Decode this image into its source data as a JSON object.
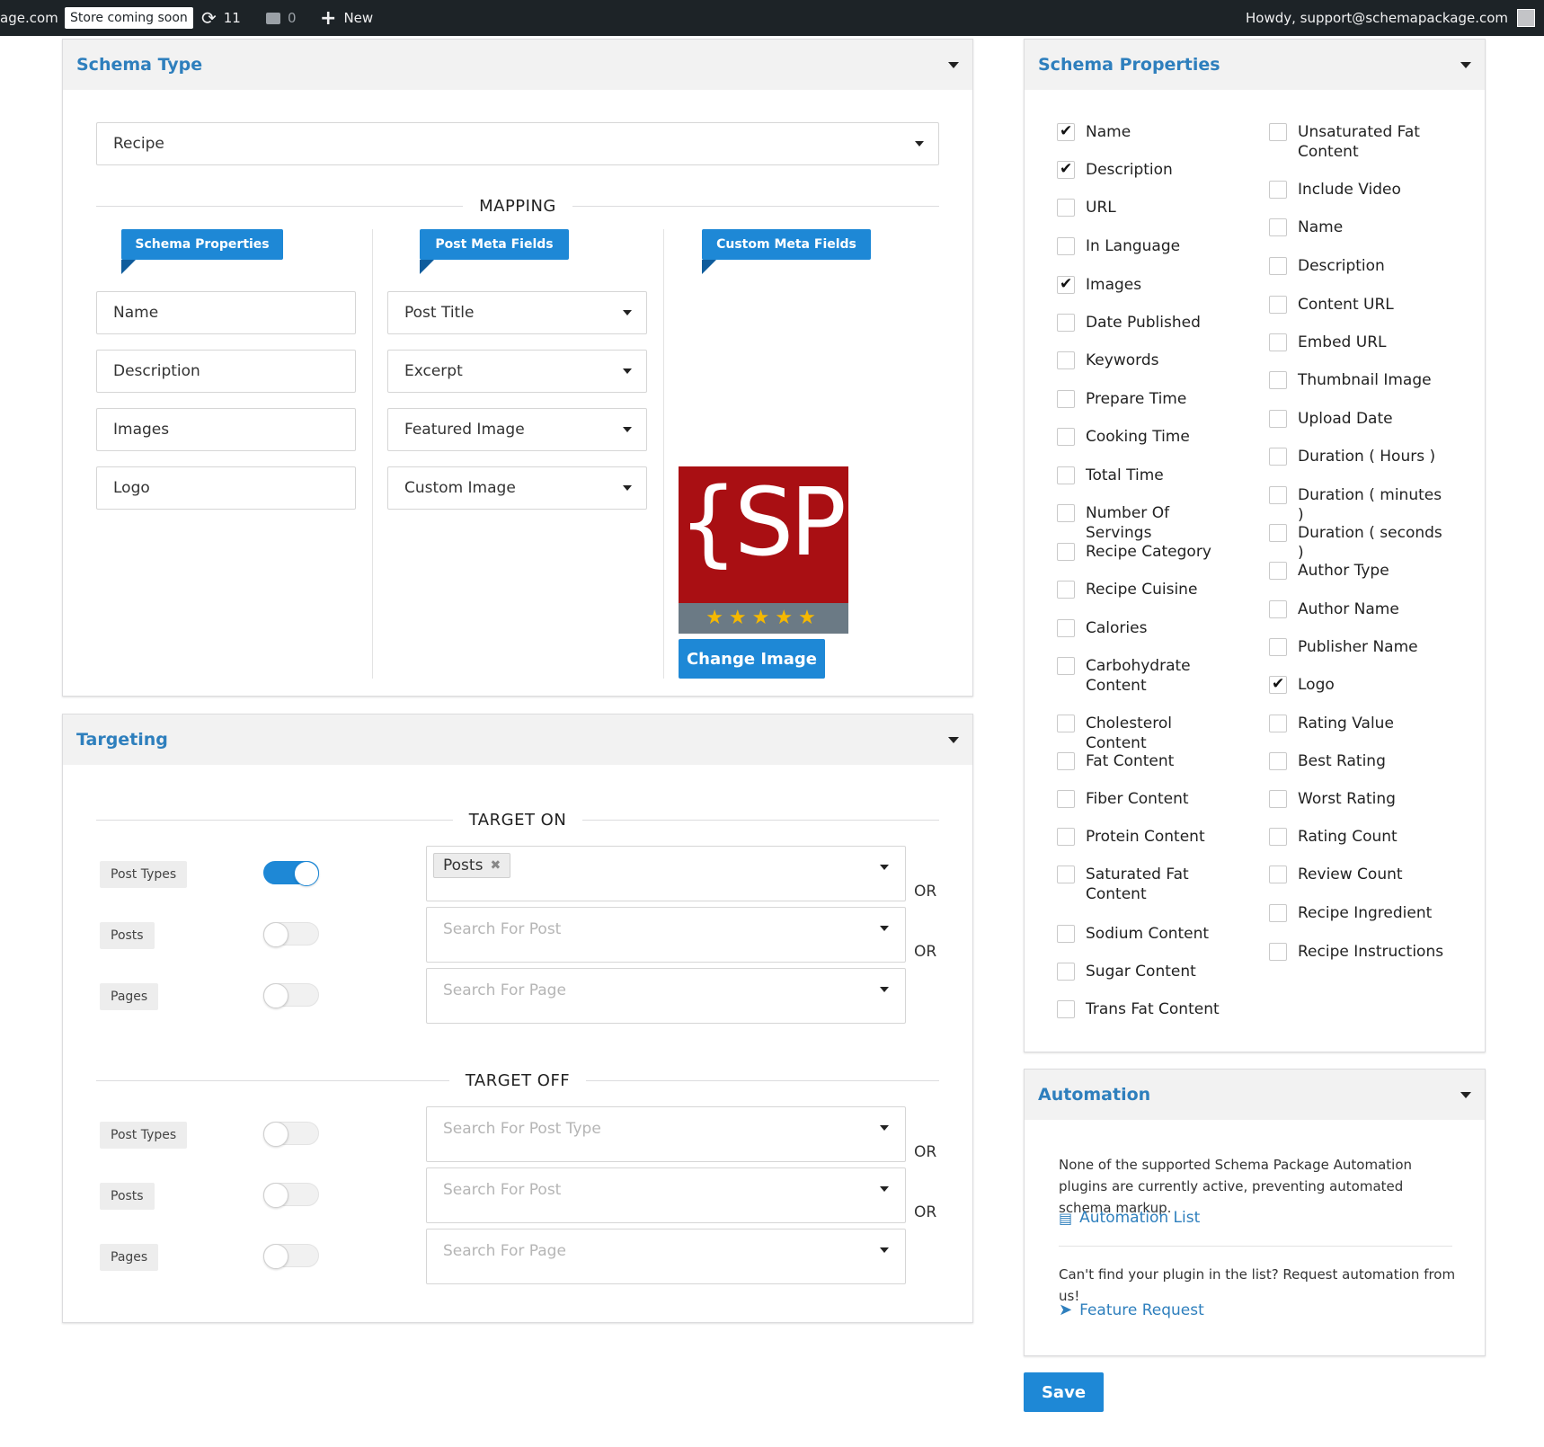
{
  "admin_bar": {
    "site": "age.com",
    "store_badge": "Store coming soon",
    "updates": "11",
    "comments": "0",
    "new": "New",
    "howdy": "Howdy, support@schemapackage.com"
  },
  "schema_type": {
    "title": "Schema Type",
    "selected": "Recipe",
    "mapping_title": "MAPPING",
    "columns": [
      "Schema Properties",
      "Post Meta Fields",
      "Custom Meta Fields"
    ],
    "rows": [
      {
        "property": "Name",
        "meta": "Post Title"
      },
      {
        "property": "Description",
        "meta": "Excerpt"
      },
      {
        "property": "Images",
        "meta": "Featured Image"
      },
      {
        "property": "Logo",
        "meta": "Custom Image"
      }
    ],
    "logo_text": "{SP}",
    "logo_stars": "★★★★★",
    "change_image": "Change Image"
  },
  "targeting": {
    "title": "Targeting",
    "target_on": "TARGET ON",
    "target_off": "TARGET OFF",
    "on_rows": [
      {
        "label": "Post Types",
        "on": true,
        "chip": "Posts",
        "placeholder": "",
        "or": "OR"
      },
      {
        "label": "Posts",
        "on": false,
        "chip": "",
        "placeholder": "Search For Post",
        "or": "OR"
      },
      {
        "label": "Pages",
        "on": false,
        "chip": "",
        "placeholder": "Search For Page",
        "or": ""
      }
    ],
    "off_rows": [
      {
        "label": "Post Types",
        "on": false,
        "placeholder": "Search For Post Type",
        "or": "OR"
      },
      {
        "label": "Posts",
        "on": false,
        "placeholder": "Search For Post",
        "or": "OR"
      },
      {
        "label": "Pages",
        "on": false,
        "placeholder": "Search For Page",
        "or": ""
      }
    ]
  },
  "schema_properties": {
    "title": "Schema Properties",
    "left": [
      {
        "label": "Name",
        "checked": true
      },
      {
        "label": "Description",
        "checked": true
      },
      {
        "label": "URL",
        "checked": false
      },
      {
        "label": "In Language",
        "checked": false
      },
      {
        "label": "Images",
        "checked": true
      },
      {
        "label": "Date Published",
        "checked": false
      },
      {
        "label": "Keywords",
        "checked": false
      },
      {
        "label": "Prepare Time",
        "checked": false
      },
      {
        "label": "Cooking Time",
        "checked": false
      },
      {
        "label": "Total Time",
        "checked": false
      },
      {
        "label": "Number Of Servings",
        "checked": false
      },
      {
        "label": "Recipe Category",
        "checked": false
      },
      {
        "label": "Recipe Cuisine",
        "checked": false
      },
      {
        "label": "Calories",
        "checked": false
      },
      {
        "label": "Carbohydrate Content",
        "checked": false
      },
      {
        "label": "Cholesterol Content",
        "checked": false
      },
      {
        "label": "Fat Content",
        "checked": false
      },
      {
        "label": "Fiber Content",
        "checked": false
      },
      {
        "label": "Protein Content",
        "checked": false
      },
      {
        "label": "Saturated Fat Content",
        "checked": false
      },
      {
        "label": "Sodium Content",
        "checked": false
      },
      {
        "label": "Sugar Content",
        "checked": false
      },
      {
        "label": "Trans Fat Content",
        "checked": false
      }
    ],
    "right": [
      {
        "label": "Unsaturated Fat Content",
        "checked": false
      },
      {
        "label": "Include Video",
        "checked": false
      },
      {
        "label": "Name",
        "checked": false
      },
      {
        "label": "Description",
        "checked": false
      },
      {
        "label": "Content URL",
        "checked": false
      },
      {
        "label": "Embed URL",
        "checked": false
      },
      {
        "label": "Thumbnail Image",
        "checked": false
      },
      {
        "label": "Upload Date",
        "checked": false
      },
      {
        "label": "Duration ( Hours )",
        "checked": false
      },
      {
        "label": "Duration ( minutes )",
        "checked": false
      },
      {
        "label": "Duration ( seconds )",
        "checked": false
      },
      {
        "label": "Author Type",
        "checked": false
      },
      {
        "label": "Author Name",
        "checked": false
      },
      {
        "label": "Publisher Name",
        "checked": false
      },
      {
        "label": "Logo",
        "checked": true
      },
      {
        "label": "Rating Value",
        "checked": false
      },
      {
        "label": "Best Rating",
        "checked": false
      },
      {
        "label": "Worst Rating",
        "checked": false
      },
      {
        "label": "Rating Count",
        "checked": false
      },
      {
        "label": "Review Count",
        "checked": false
      },
      {
        "label": "Recipe Ingredient",
        "checked": false
      },
      {
        "label": "Recipe Instructions",
        "checked": false
      }
    ]
  },
  "automation": {
    "title": "Automation",
    "message": "None of the supported Schema Package Automation plugins are currently active, preventing automated schema markup.",
    "list_link": "Automation List",
    "request_text": "Can't find your plugin in the list? Request automation from us!",
    "feature_link": "Feature Request"
  },
  "save_label": "Save",
  "colors": {
    "accent": "#1e88d6",
    "title": "#2e7fbd",
    "logo_bg": "#a90f13",
    "admin_bar": "#1d2327"
  }
}
